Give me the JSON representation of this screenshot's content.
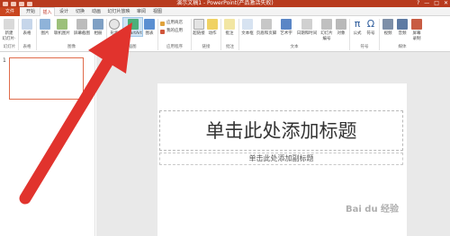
{
  "titlebar": {
    "title": "演示文稿1 - PowerPoint(产品激活失败)",
    "help": "?",
    "minimize": "—",
    "maximize": "□",
    "close": "✕"
  },
  "tabs": [
    "文件",
    "开始",
    "插入",
    "设计",
    "切换",
    "动画",
    "幻灯片放映",
    "审阅",
    "视图"
  ],
  "ribbon": {
    "buttons": [
      {
        "label1": "新建",
        "label2": "幻灯片·"
      },
      {
        "label1": "表格",
        "label2": ""
      },
      {
        "label1": "图片",
        "label2": ""
      },
      {
        "label1": "联机图片",
        "label2": ""
      },
      {
        "label1": "屏幕截图",
        "label2": ""
      },
      {
        "label1": "相册",
        "label2": ""
      },
      {
        "label1": "形状",
        "label2": ""
      },
      {
        "label1": "SmartArt",
        "label2": ""
      },
      {
        "label1": "图表",
        "label2": ""
      },
      {
        "label1": "超链接",
        "label2": ""
      },
      {
        "label1": "动作",
        "label2": ""
      },
      {
        "label1": "批注",
        "label2": ""
      },
      {
        "label1": "文本框",
        "label2": ""
      },
      {
        "label1": "页眉和页脚",
        "label2": ""
      },
      {
        "label1": "艺术字",
        "label2": ""
      },
      {
        "label1": "日期和时间",
        "label2": ""
      },
      {
        "label1": "幻灯片",
        "label2": "编号"
      },
      {
        "label1": "对象",
        "label2": ""
      },
      {
        "label1": "公式",
        "label2": ""
      },
      {
        "label1": "符号",
        "label2": ""
      },
      {
        "label1": "视频",
        "label2": ""
      },
      {
        "label1": "音频",
        "label2": ""
      },
      {
        "label1": "屏幕",
        "label2": "录制"
      }
    ],
    "apps_store": "应用商店",
    "my_apps": "我的应用",
    "groups": [
      "幻灯片",
      "表格",
      "图像",
      "插图",
      "应用程序",
      "链接",
      "批注",
      "文本",
      "符号",
      "媒体"
    ]
  },
  "slides": {
    "number": "1"
  },
  "slide": {
    "title_placeholder": "单击此处添加标题",
    "subtitle_placeholder": "单击此处添加副标题"
  },
  "watermark": "Bai du 经验",
  "colors": {
    "accent": "#c9451f",
    "arrow": "#e1332d"
  }
}
